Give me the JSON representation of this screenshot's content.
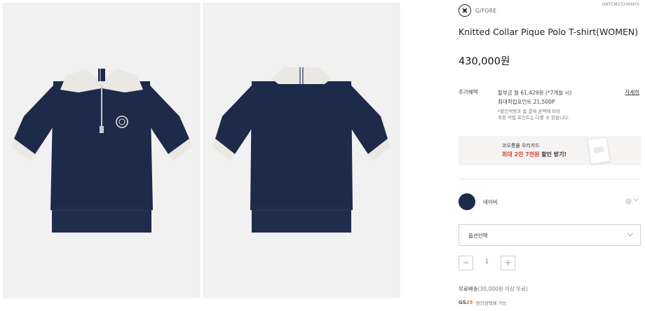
{
  "product": {
    "brand": "G/FORE",
    "sku": "GNTCM23306NYX",
    "title": "Knitted Collar Pique Polo T-shirt(WOMEN)",
    "price": "430,000원"
  },
  "benefits": {
    "label": "추가혜택",
    "installment": "할부금 월 61,429원 (*7개월 시)",
    "points": "최대적립포인트 21,500P",
    "note_line1": "*할인적용과 쉼 결제 금액에 따라",
    "note_line2": "최종 적립 포인트는 다를 수 있습니다.",
    "detail_link": "자세히"
  },
  "banner": {
    "line1": "코오롱몰 우리카드",
    "line2_highlight": "최대 2만 7천원",
    "line2_rest": " 할인 받기!"
  },
  "color": {
    "selected_name": "네이비",
    "swatches": [
      "#1e2a4a",
      "#dddddd"
    ]
  },
  "option_select": {
    "label": "옵션선택"
  },
  "quantity": {
    "minus": "−",
    "value": "1",
    "plus": "+"
  },
  "shipping": {
    "label": "무료배송",
    "condition": "(30,000원 이상 무료)"
  },
  "payment": {
    "logo_prefix": "GS",
    "logo_num": "25",
    "text": "편의점택배 가능"
  },
  "colors": {
    "navy": "#1e2a4a",
    "cream": "#eae8e2",
    "panel_bg": "#f1f1f1",
    "accent_red": "#d9423a"
  },
  "icons": {
    "brand": "brand-logo-icon",
    "color_dropdown": "chevron-down-icon",
    "option_dropdown": "chevron-down-icon"
  }
}
